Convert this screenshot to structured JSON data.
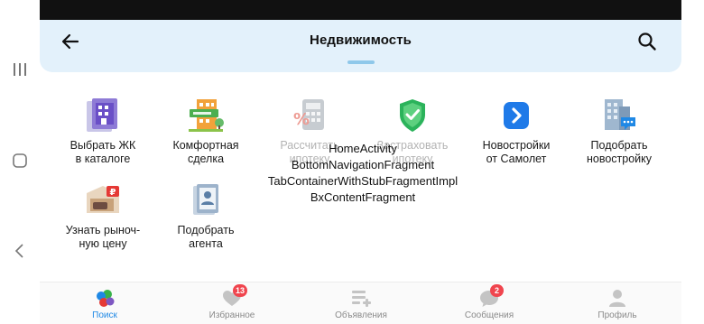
{
  "header": {
    "title": "Недвижимость",
    "back_icon": "arrow-left-icon",
    "search_icon": "search-icon"
  },
  "tiles": [
    {
      "label_1": "Выбрать ЖК",
      "label_2": "в каталоге",
      "icon": "building-catalog-icon"
    },
    {
      "label_1": "Комфортная",
      "label_2": "сделка",
      "icon": "sold-house-icon"
    },
    {
      "label_1": "Рассчитать",
      "label_2": "ипотеку",
      "icon": "calculator-percent-icon"
    },
    {
      "label_1": "Застраховать",
      "label_2": "ипотеку",
      "icon": "shield-check-icon"
    },
    {
      "label_1": "Новостройки",
      "label_2": "от Самолет",
      "icon": "samolet-logo-icon"
    },
    {
      "label_1": "Подобрать",
      "label_2": "новостройку",
      "icon": "building-chat-icon"
    },
    {
      "label_1": "Узнать рыноч-",
      "label_2": "ную цену",
      "icon": "room-price-icon"
    },
    {
      "label_1": "Подобрать",
      "label_2": "агента",
      "icon": "agent-card-icon"
    }
  ],
  "debug_overlay": {
    "line_1": "HomeActivity",
    "line_2": "BottomNavigationFragment",
    "line_3": "TabContainerWithStubFragmentImpl",
    "line_4": "BxContentFragment"
  },
  "bottom_nav": [
    {
      "label": "Поиск",
      "icon": "search-bubbles-icon",
      "badge": ""
    },
    {
      "label": "Избранное",
      "icon": "heart-icon",
      "badge": "13"
    },
    {
      "label": "Объявления",
      "icon": "add-listing-icon",
      "badge": ""
    },
    {
      "label": "Сообщения",
      "icon": "chat-icon",
      "badge": "2"
    },
    {
      "label": "Профиль",
      "icon": "profile-icon",
      "badge": ""
    }
  ],
  "colors": {
    "accent": "#1e88e5",
    "header_bg": "#e3f1fb",
    "badge": "#f0454e"
  }
}
